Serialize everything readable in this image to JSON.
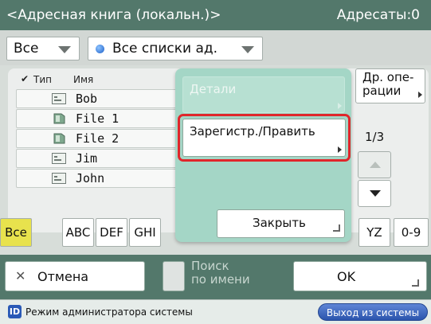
{
  "titlebar": {
    "title": "<Адресная книга (локальн.)>",
    "count": "Адресаты:0"
  },
  "filter": {
    "type_value": "Все",
    "list_value": "Все списки ад."
  },
  "list": {
    "headers": {
      "type": "Тип",
      "name": "Имя"
    },
    "rows": [
      {
        "name": "Bob",
        "icon": "fax-icon"
      },
      {
        "name": "File 1",
        "icon": "file-server-icon"
      },
      {
        "name": "File 2",
        "icon": "file-server-icon"
      },
      {
        "name": "Jim",
        "icon": "fax-icon"
      },
      {
        "name": "John",
        "icon": "fax-icon"
      }
    ]
  },
  "side": {
    "other_ops": "Др. опе-\nрации",
    "page": "1/3"
  },
  "alpha_tabs": [
    "Все",
    "ABC",
    "DEF",
    "GHI",
    "YZ",
    "0-9"
  ],
  "popup": {
    "details": "Детали",
    "register_edit": "Зарегистр./Править",
    "close": "Закрыть"
  },
  "bottom": {
    "cancel": "Отмена",
    "search": "Поиск\nпо имени",
    "ok": "OK"
  },
  "status": {
    "icon_letter": "ID",
    "mode_text": "Режим администратора системы",
    "logout": "Выход из системы"
  },
  "colors": {
    "header": "#53786b",
    "popup": "#a4d6c6",
    "selected_tab": "#e8e24d",
    "highlight": "#e0262b"
  }
}
